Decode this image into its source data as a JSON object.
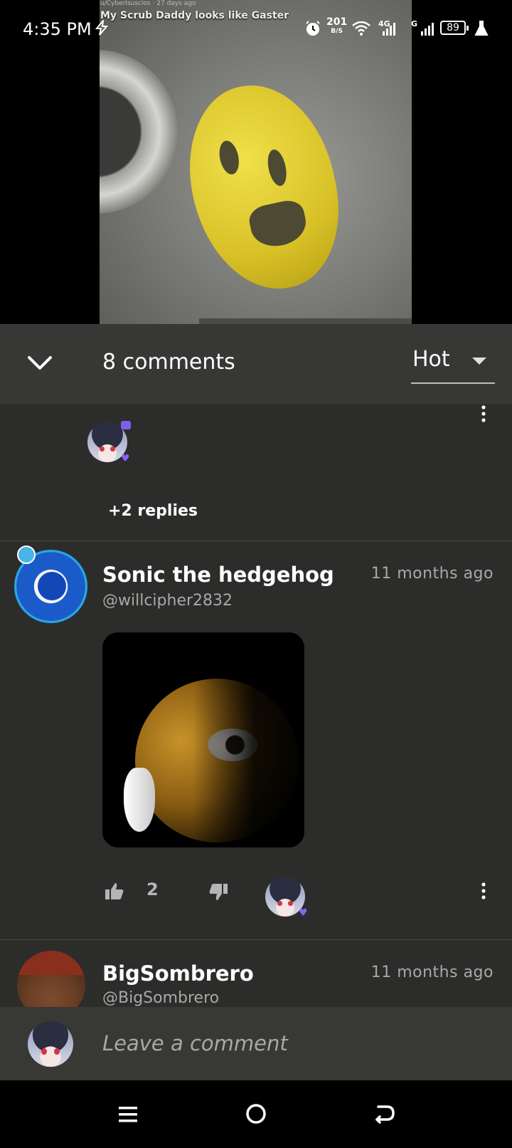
{
  "status_bar": {
    "time": "4:35 PM",
    "speed_value": "201",
    "speed_unit": "B/S",
    "network_4g": "4G",
    "network_g": "G",
    "battery": "89"
  },
  "video": {
    "subtitle": "u/CyberIsuscios · 27 days ago",
    "title": "My Scrub Daddy looks like Gaster"
  },
  "comments_header": {
    "count_label": "8 comments",
    "sort_label": "Hot"
  },
  "previous_thread": {
    "replies_label": "+2 replies"
  },
  "comments": [
    {
      "author": "Sonic the hedgehog",
      "handle": "@willcipher2832",
      "time": "11 months ago",
      "likes": "2"
    },
    {
      "author": "BigSombrero",
      "handle": "@BigSombrero",
      "time": "11 months ago"
    }
  ],
  "comment_input": {
    "placeholder": "Leave a comment"
  },
  "icons": {
    "collapse": "chevron-down-icon",
    "sort": "caret-down-icon",
    "more": "more-vertical-icon",
    "like": "thumbs-up-icon",
    "dislike": "thumbs-down-icon",
    "nav_menu": "menu-icon",
    "nav_home": "home-circle-icon",
    "nav_back": "back-arrow-icon"
  },
  "colors": {
    "background": "#2c2d2b",
    "header": "#373835",
    "heart_badge": "#8a62f5",
    "muted_text": "#a8a8a8"
  }
}
